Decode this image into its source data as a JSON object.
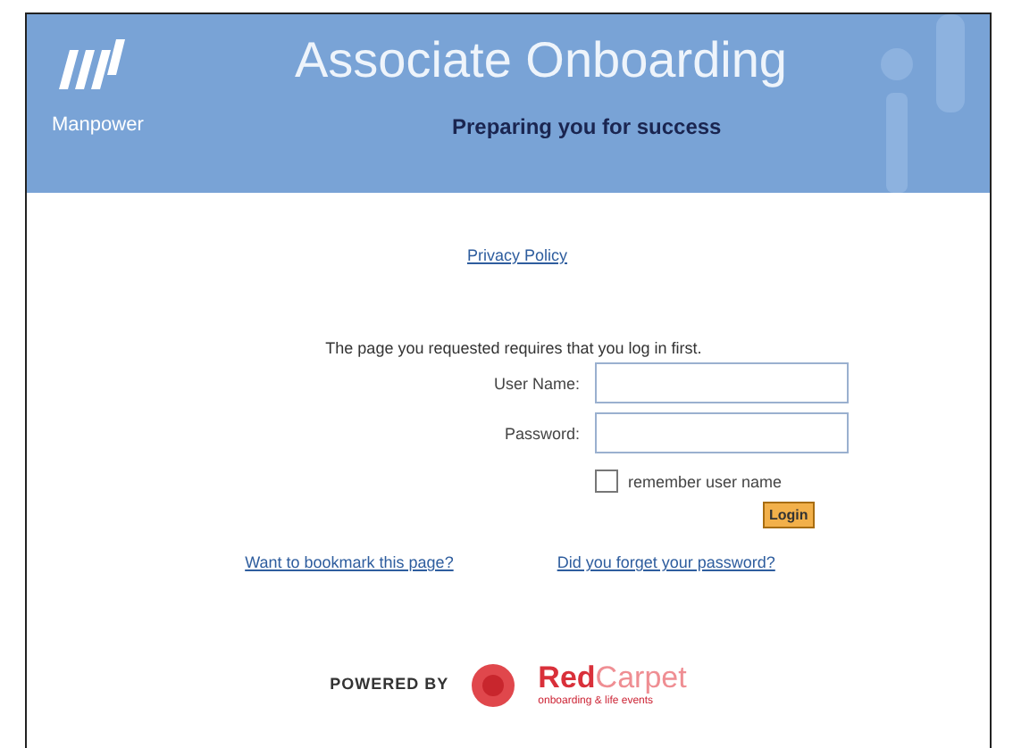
{
  "header": {
    "brand": "Manpower",
    "title": "Associate Onboarding",
    "subtitle": "Preparing you for success"
  },
  "privacy_link": "Privacy Policy",
  "message": "The page you requested requires that you log in first.",
  "form": {
    "fields": [
      {
        "label": "User Name:"
      },
      {
        "label": "Password:"
      }
    ],
    "remember": {
      "label": "remember user name",
      "checked": false
    },
    "login_button": "Login"
  },
  "links": [
    "Want to bookmark this page?",
    "Did you forget your password?"
  ],
  "footer": {
    "powered_by": "POWERED BY",
    "brand_red": "Red",
    "brand_light": "Carpet",
    "tagline": "onboarding & life events"
  }
}
